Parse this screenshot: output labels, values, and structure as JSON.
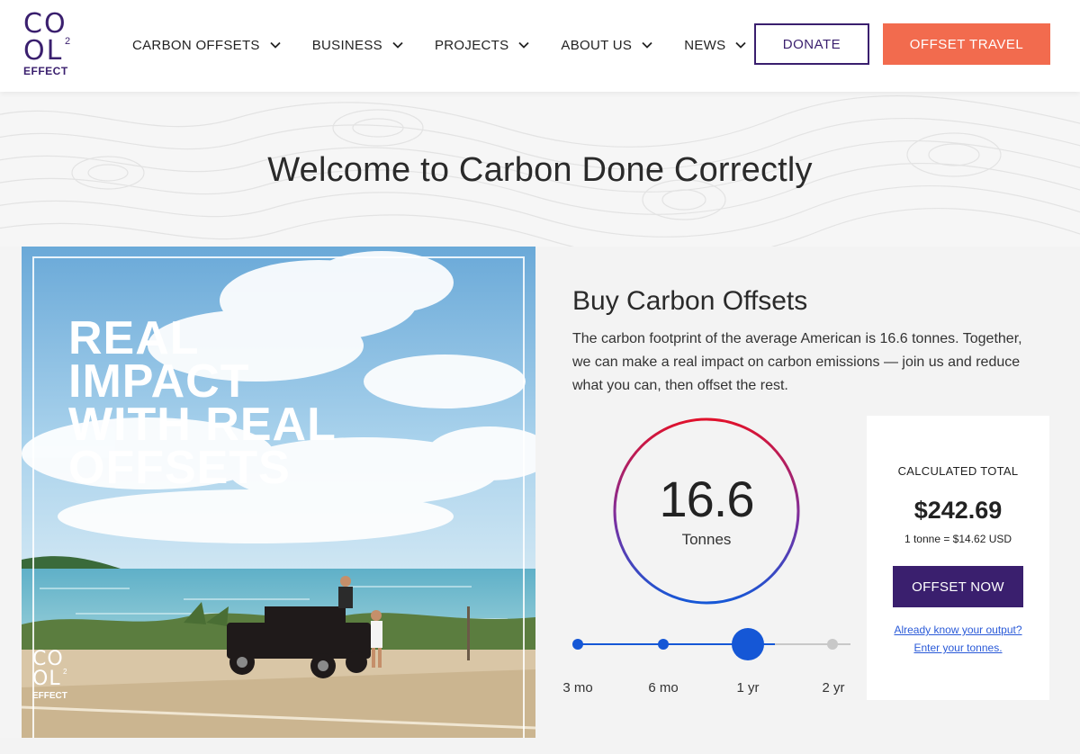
{
  "header": {
    "logo": {
      "line1": "CO",
      "line2": "OL",
      "superscript": "2",
      "line3": "EFFECT"
    },
    "nav": [
      {
        "label": "CARBON OFFSETS"
      },
      {
        "label": "BUSINESS"
      },
      {
        "label": "PROJECTS"
      },
      {
        "label": "ABOUT US"
      },
      {
        "label": "NEWS"
      }
    ],
    "donate_label": "DONATE",
    "offset_travel_label": "OFFSET TRAVEL"
  },
  "hero": {
    "welcome_title": "Welcome to Carbon Done Correctly",
    "image_text": [
      "REAL",
      "IMPACT",
      "WITH REAL",
      "OFFSETS"
    ],
    "image_logo": {
      "line1": "CO",
      "line2": "OL",
      "superscript": "2",
      "line3": "EFFECT"
    }
  },
  "offset_panel": {
    "title": "Buy Carbon Offsets",
    "description": "The carbon footprint of the average American is 16.6 tonnes. Together, we can make a real impact on carbon emissions — join us and reduce what you can, then offset the rest.",
    "gauge": {
      "value": "16.6",
      "unit": "Tonnes"
    },
    "slider": {
      "options": [
        "3 mo",
        "6 mo",
        "1 yr",
        "2 yr"
      ],
      "selected_index": 2
    },
    "total": {
      "label": "CALCULATED TOTAL",
      "amount": "$242.69",
      "rate": "1 tonne = $14.62 USD",
      "offset_now_label": "OFFSET NOW",
      "link_line1": "Already know your output?",
      "link_line2": "Enter your tonnes."
    }
  },
  "colors": {
    "brand_purple": "#3a1f6e",
    "accent_coral": "#f26b4e",
    "slider_blue": "#1557d6",
    "gauge_red": "#e0112b",
    "link_blue": "#2a5ad8"
  },
  "icons": {
    "nav_dropdown": "chevron-down-icon"
  }
}
